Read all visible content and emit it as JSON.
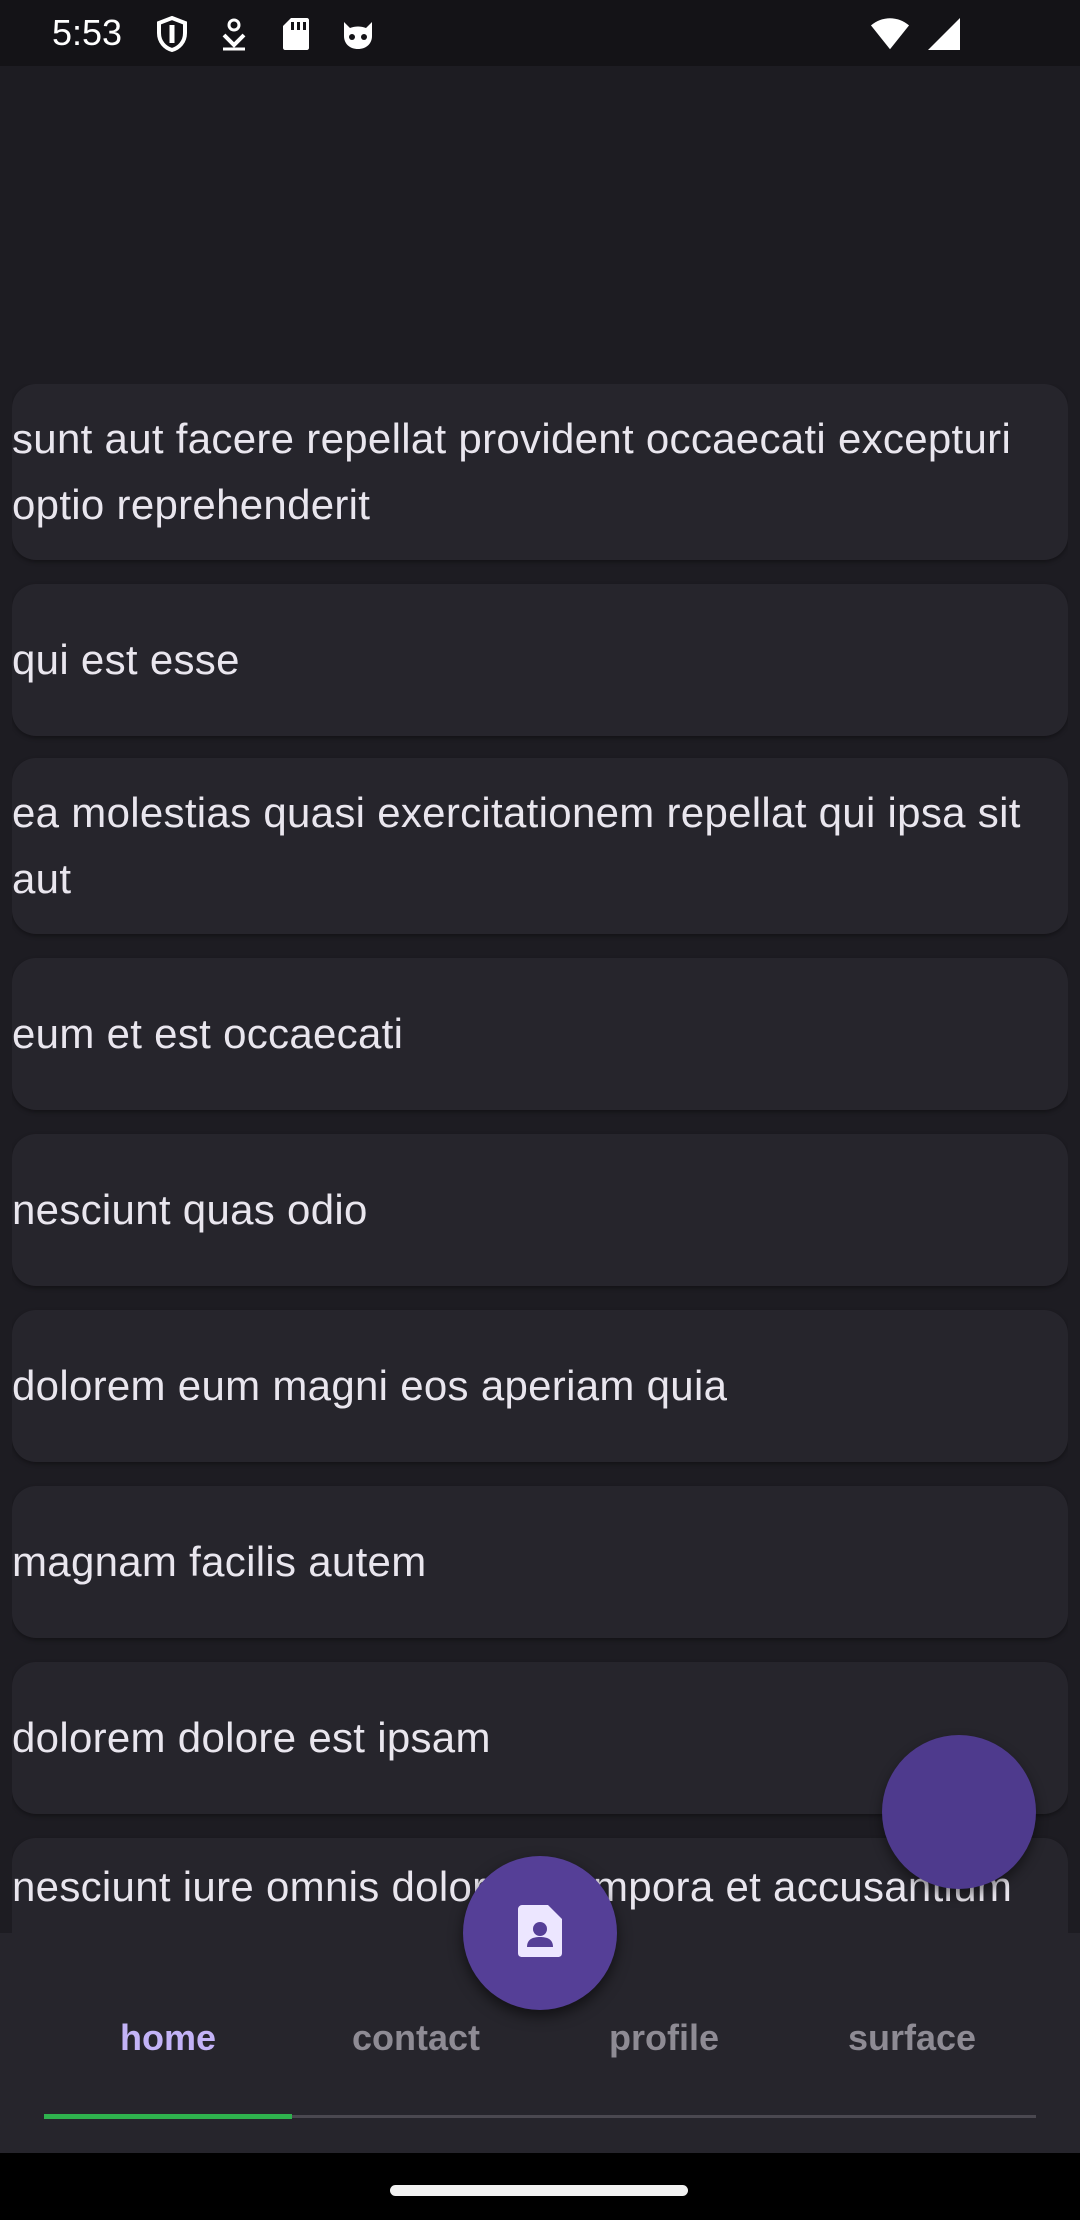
{
  "status_bar": {
    "time": "5:53",
    "left_icons": [
      "shield-icon",
      "download-icon",
      "sd-card-icon",
      "cat-icon"
    ],
    "right_icons": [
      "wifi-icon",
      "signal-icon"
    ]
  },
  "posts": [
    {
      "title": "sunt aut facere repellat provident occaecati excepturi optio reprehenderit"
    },
    {
      "title": "qui est esse"
    },
    {
      "title": "ea molestias quasi exercitationem repellat qui ipsa sit aut"
    },
    {
      "title": "eum et est occaecati"
    },
    {
      "title": "nesciunt quas odio"
    },
    {
      "title": "dolorem eum magni eos aperiam quia"
    },
    {
      "title": "magnam facilis autem"
    },
    {
      "title": "dolorem dolore est ipsam"
    },
    {
      "title": "nesciunt iure omnis dolorem tempora et accusantium"
    }
  ],
  "fab": {
    "center_icon": "contact-page-icon",
    "accent_color": "#553f97"
  },
  "bottom_nav": {
    "tabs": [
      {
        "label": "home",
        "active": true
      },
      {
        "label": "contact",
        "active": false
      },
      {
        "label": "profile",
        "active": false
      },
      {
        "label": "surface",
        "active": false
      }
    ],
    "indicator_color": "#2fb24e",
    "active_color": "#c3b3f7"
  }
}
